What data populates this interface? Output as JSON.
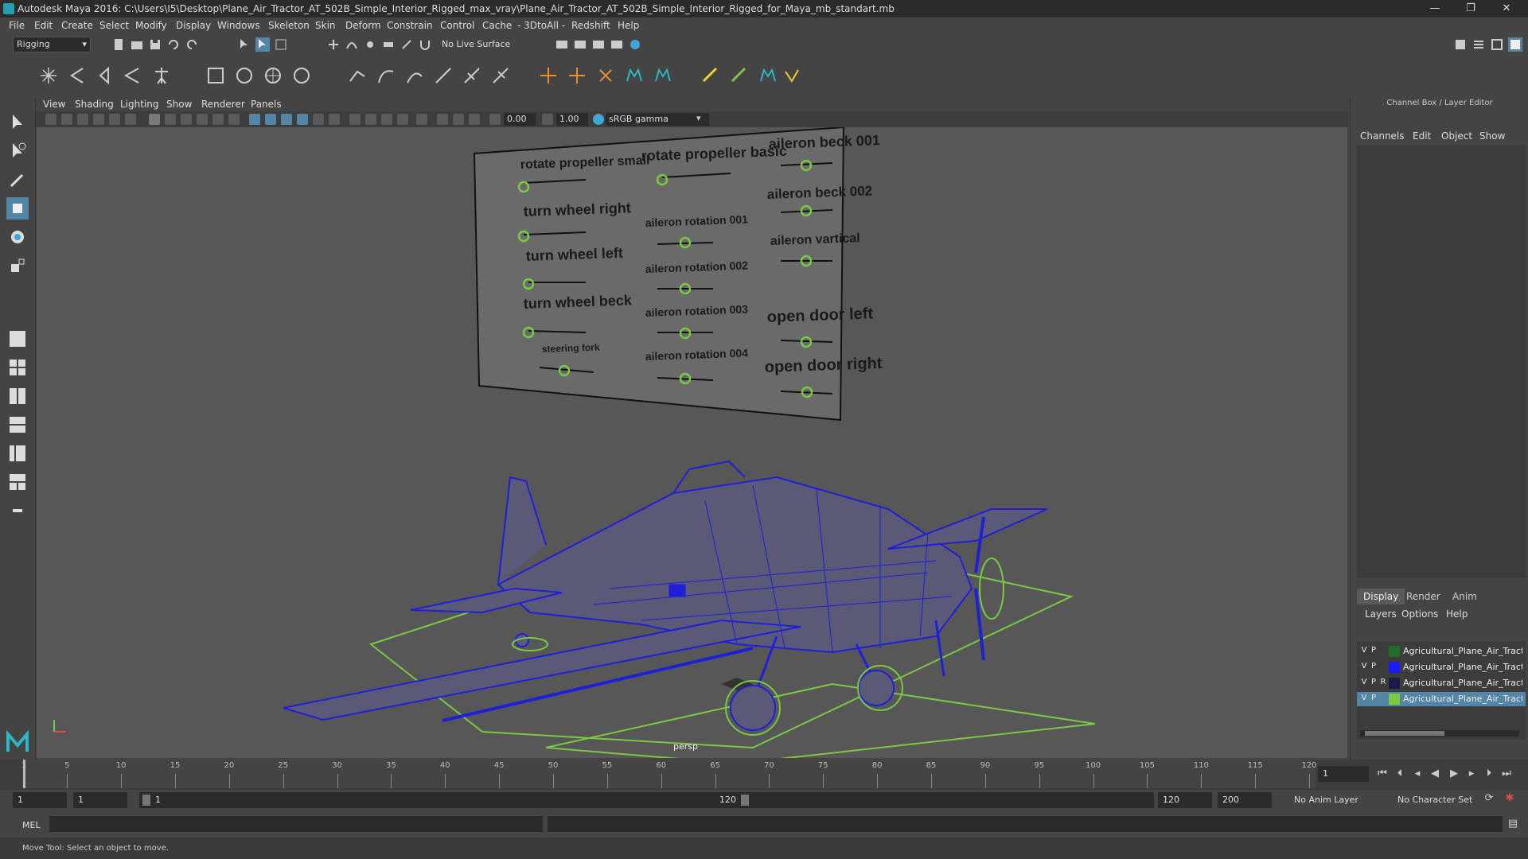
{
  "window": {
    "title": "Autodesk Maya 2016: C:\\Users\\I5\\Desktop\\Plane_Air_Tractor_AT_502B_Simple_Interior_Rigged_max_vray\\Plane_Air_Tractor_AT_502B_Simple_Interior_Rigged_for_Maya_mb_standart.mb",
    "minimize": "—",
    "maximize": "❐",
    "close": "✕"
  },
  "menubar": [
    "File",
    "Edit",
    "Create",
    "Select",
    "Modify",
    "Display",
    "Windows",
    "Skeleton",
    "Skin",
    "Deform",
    "Constrain",
    "Control",
    "Cache",
    "- 3DtoAll -",
    "Redshift",
    "Help"
  ],
  "statusline": {
    "mode": "Rigging",
    "live_surface": "No Live Surface"
  },
  "viewport": {
    "menus": [
      "View",
      "Shading",
      "Lighting",
      "Show",
      "Renderer",
      "Panels"
    ],
    "exposure": "0.00",
    "gamma": "1.00",
    "colorspace": "sRGB gamma",
    "camera": "persp"
  },
  "control_board": {
    "labels": [
      "rotate propeller small",
      "rotate propeller basic",
      "aileron beck 001",
      "turn wheel right",
      "aileron rotation 001",
      "aileron beck 002",
      "turn wheel left",
      "aileron rotation 002",
      "aileron vartical",
      "turn wheel beck",
      "aileron rotation 003",
      "open door left",
      "steering fork",
      "aileron rotation 004",
      "open door right"
    ]
  },
  "channel_box": {
    "title": "Channel Box / Layer Editor",
    "menus": [
      "Channels",
      "Edit",
      "Object",
      "Show"
    ]
  },
  "layer_editor": {
    "tabs": [
      "Display",
      "Render",
      "Anim"
    ],
    "menus": [
      "Layers",
      "Options",
      "Help"
    ],
    "layers": [
      {
        "v": "V",
        "p": "P",
        "r": "",
        "name": "Agricultural_Plane_Air_Tractor",
        "color": "#1e6b2a"
      },
      {
        "v": "V",
        "p": "P",
        "r": "",
        "name": "Agricultural_Plane_Air_Tractor",
        "color": "#1a1aff"
      },
      {
        "v": "V",
        "p": "P",
        "r": "R",
        "name": "Agricultural_Plane_Air_Tractor",
        "color": "#1a1a4a"
      },
      {
        "v": "V",
        "p": "P",
        "r": "",
        "name": "Agricultural_Plane_Air_Tractor",
        "color": "#7ac943"
      }
    ]
  },
  "timeline": {
    "ticks": [
      "1",
      "5",
      "10",
      "15",
      "20",
      "25",
      "30",
      "35",
      "40",
      "45",
      "50",
      "55",
      "60",
      "65",
      "70",
      "75",
      "80",
      "85",
      "90",
      "95",
      "100",
      "105",
      "110",
      "115",
      "120"
    ],
    "current_frame": "1"
  },
  "range": {
    "start": "1",
    "playback_start": "1",
    "slider_start": "1",
    "slider_end": "120",
    "playback_end": "120",
    "end": "200",
    "anim_layer": "No Anim Layer",
    "character_set": "No Character Set"
  },
  "cmdline": {
    "label": "MEL"
  },
  "helpline": {
    "text": "Move Tool: Select an object to move."
  },
  "colors": {
    "wire": "#1f1fd8",
    "control": "#7ac943",
    "accent": "#5285a6"
  }
}
